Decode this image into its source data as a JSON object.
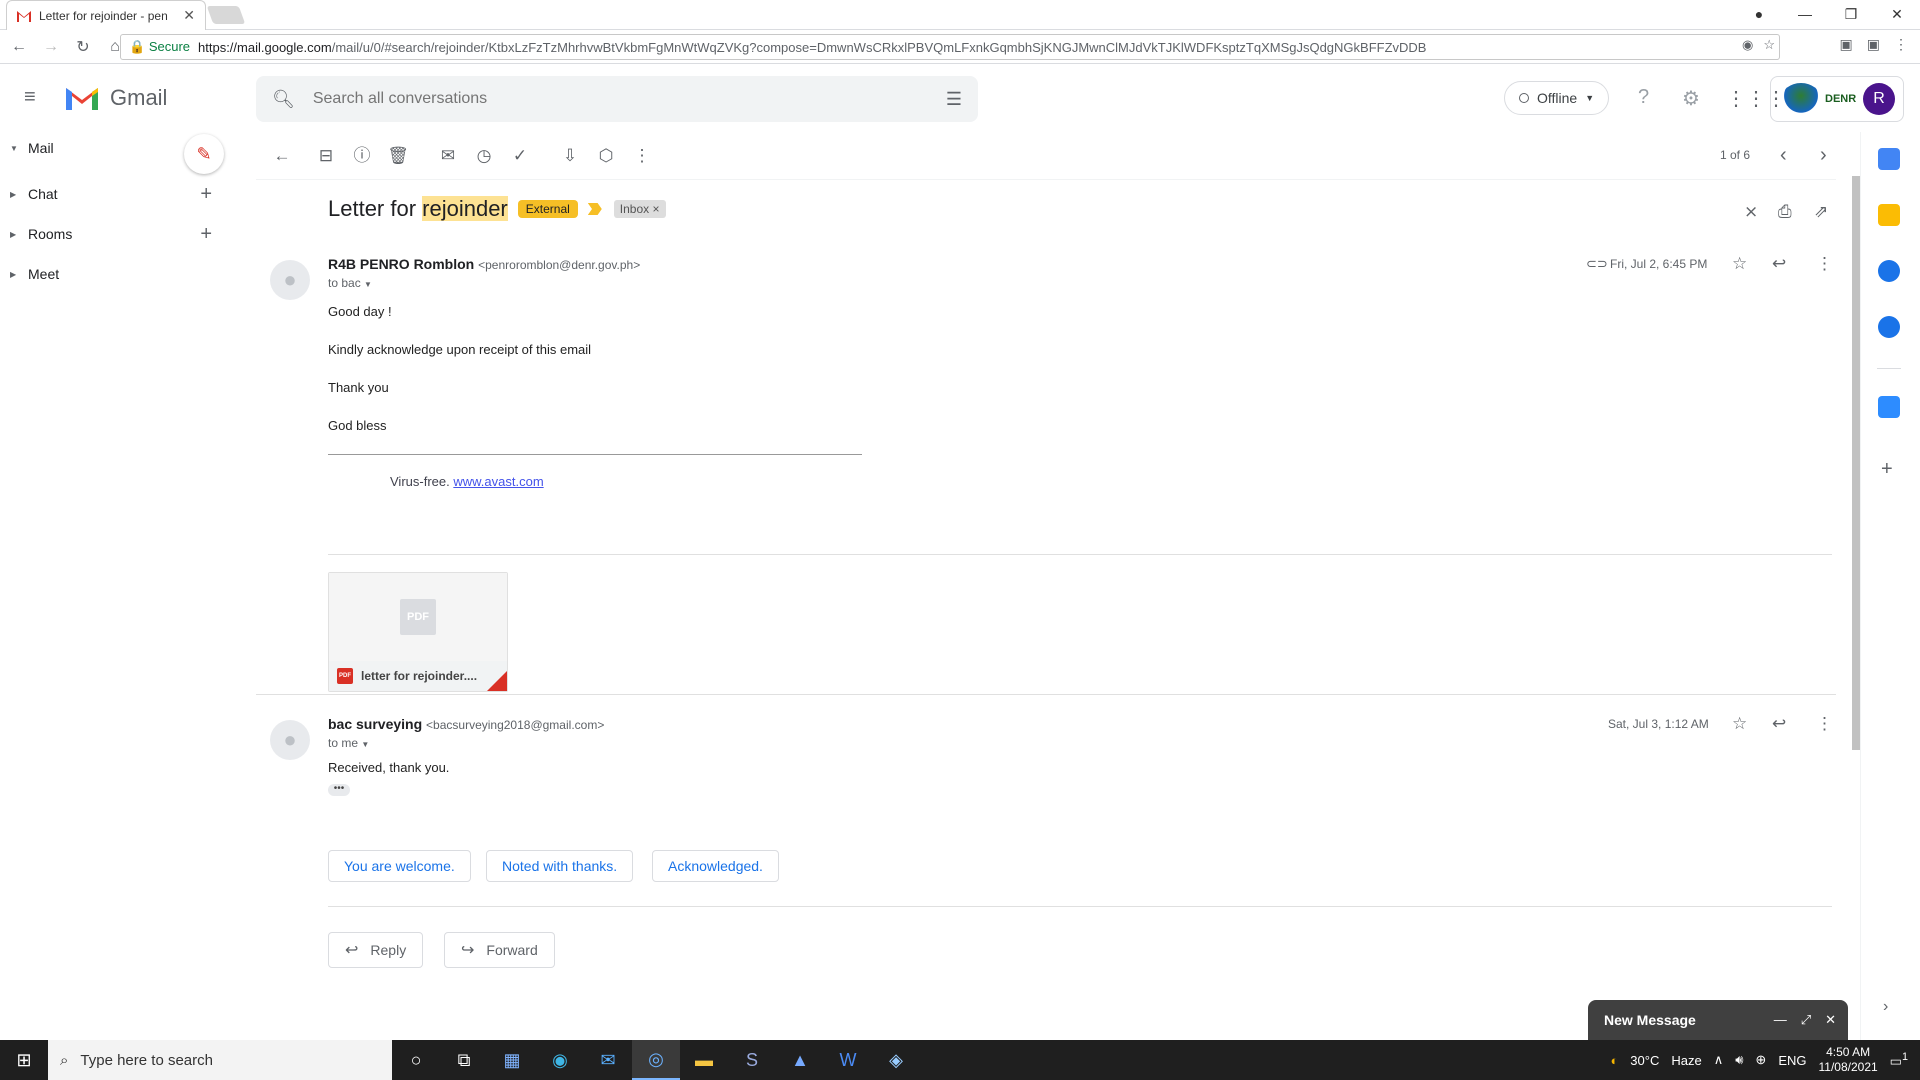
{
  "browser": {
    "tab_title": "Letter for rejoinder - pen",
    "secure_label": "Secure",
    "url_host": "https://mail.google.com",
    "url_rest": "/mail/u/0/#search/rejoinder/KtbxLzFzTzMhrhvwBtVkbmFgMnWtWqZVKg?compose=DmwnWsCRkxlPBVQmLFxnkGqmbhSjKNGJMwnClMJdVkTJKlWDFKsptzTqXMSgJsQdgNGkBFFZvDDB"
  },
  "header": {
    "app_name": "Gmail",
    "search_placeholder": "Search all conversations",
    "status_label": "Offline",
    "org_logo_text": "DENR",
    "avatar_initial": "R"
  },
  "sidebar": {
    "items": [
      {
        "label": "Mail"
      },
      {
        "label": "Chat"
      },
      {
        "label": "Rooms"
      },
      {
        "label": "Meet"
      }
    ]
  },
  "toolbar": {
    "pager": "1 of 6"
  },
  "thread": {
    "subject_prefix": "Letter for ",
    "subject_highlight": "rejoinder",
    "label_external": "External",
    "label_inbox": "Inbox",
    "label_inbox_remove": "×"
  },
  "message1": {
    "sender_name": "R4B PENRO Romblon",
    "sender_email": "<penroromblon@denr.gov.ph>",
    "to": "to bac",
    "date": "Fri, Jul 2, 6:45 PM",
    "lines": [
      "Good day !",
      "Kindly acknowledge upon receipt of this email",
      "Thank you",
      "God bless"
    ],
    "virus_text": "Virus-free. ",
    "virus_link": "www.avast.com",
    "attachment_name": "letter for rejoinder....",
    "attachment_preview": "PDF",
    "attachment_icon": "PDF"
  },
  "message2": {
    "sender_name": "bac surveying",
    "sender_email": "<bacsurveying2018@gmail.com>",
    "to": "to me",
    "date": "Sat, Jul 3, 1:12 AM",
    "body": "Received, thank you.",
    "ellipsis": "•••"
  },
  "smart_replies": [
    "You are welcome.",
    "Noted with thanks.",
    "Acknowledged."
  ],
  "actions": {
    "reply": "Reply",
    "forward": "Forward"
  },
  "compose_popup": {
    "title": "New Message"
  },
  "taskbar": {
    "search_placeholder": "Type here to search",
    "temperature": "30°C",
    "weather": "Haze",
    "language": "ENG",
    "time": "4:50 AM",
    "date": "11/08/2021",
    "notification_count": "1"
  }
}
